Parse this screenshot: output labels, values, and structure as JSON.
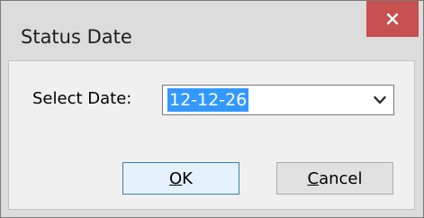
{
  "dialog": {
    "title": "Status Date",
    "close_icon": "close-icon"
  },
  "form": {
    "select_date_label": "Select Date:",
    "date_value": "12-12-26",
    "dropdown_icon": "chevron-down-icon"
  },
  "buttons": {
    "ok": {
      "mnemonic": "O",
      "rest": "K"
    },
    "cancel": {
      "mnemonic": "C",
      "rest": "ancel"
    }
  },
  "colors": {
    "close_button": "#c75050",
    "selection": "#3399ff"
  }
}
